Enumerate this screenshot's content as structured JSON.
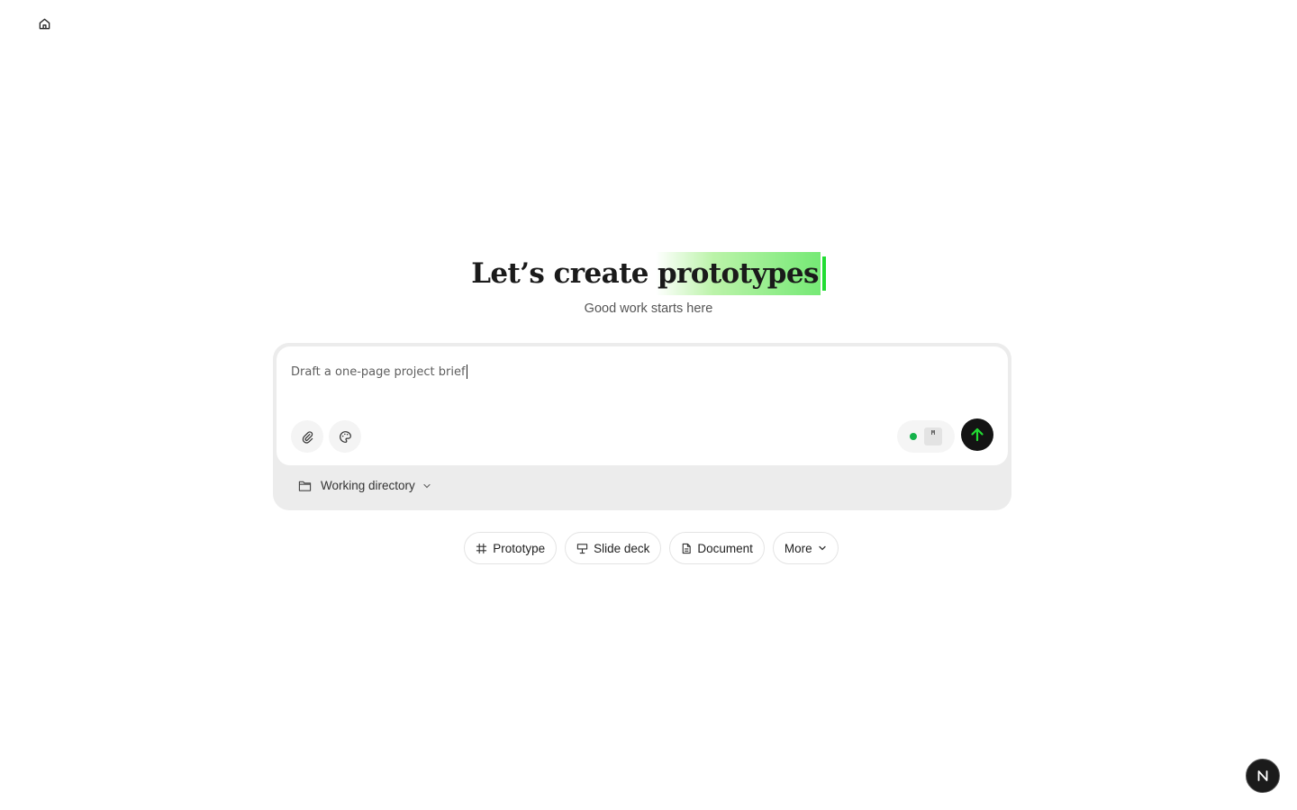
{
  "hero": {
    "headline_prefix": "Let’s create",
    "headline_highlight": "prototypes",
    "subtitle": "Good work starts here"
  },
  "composer": {
    "prompt_text": "Draft a one-page project brief",
    "model_badge": "M",
    "status_color": "#14b24a",
    "send_arrow_color": "#22dd33"
  },
  "working_directory": {
    "label": "Working directory"
  },
  "chips": [
    {
      "label": "Prototype",
      "icon": "hash-icon"
    },
    {
      "label": "Slide deck",
      "icon": "presentation-icon"
    },
    {
      "label": "Document",
      "icon": "document-icon"
    },
    {
      "label": "More",
      "icon": "chevron-down-icon"
    }
  ],
  "corner": {
    "logo_letter": "N"
  },
  "colors": {
    "highlight": "#6ee86e",
    "caret": "#22dd33",
    "composer_bg": "#ececec",
    "send_bg": "#141414"
  }
}
